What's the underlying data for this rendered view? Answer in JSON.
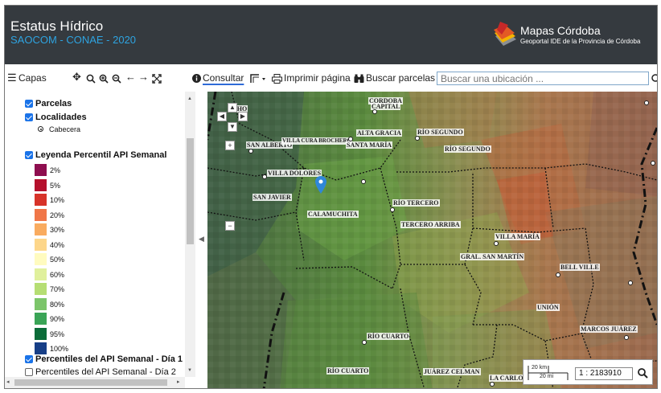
{
  "header": {
    "title": "Estatus Hídrico",
    "subtitle": "SAOCOM - CONAE - 2020",
    "logo_title": "Mapas Córdoba",
    "logo_subtitle": "Geoportal IDE de la Provincia de Córdoba",
    "colors": {
      "background": "#353a3f",
      "subtitle": "#2ea3e0"
    }
  },
  "toolbar": {
    "layers_label": "Capas",
    "consult_label": "Consultar",
    "print_label": "Imprimir página",
    "parcel_search_label": "Buscar parcelas",
    "search_placeholder": "Buscar una ubicación ...",
    "icons": [
      "menu-icon",
      "pan-icon",
      "zoom-box-icon",
      "zoom-in-icon",
      "zoom-out-icon",
      "back-icon",
      "forward-icon",
      "full-extent-icon",
      "info-icon",
      "draw-icon",
      "print-icon",
      "binoculars-icon",
      "search-icon"
    ]
  },
  "sidebar": {
    "layers": [
      {
        "label": "Parcelas",
        "checked": true
      },
      {
        "label": "Localidades",
        "checked": true
      },
      {
        "label": "Leyenda Percentil API Semanal",
        "checked": true
      },
      {
        "label": "Percentiles del API Semanal - Día 1",
        "checked": true
      },
      {
        "label": "Percentiles del API Semanal - Día 2",
        "checked": false
      }
    ],
    "localidades_sub": "Cabecera",
    "legend": [
      {
        "label": "2%",
        "color": "#8e0e4f"
      },
      {
        "label": "5%",
        "color": "#b5102c"
      },
      {
        "label": "10%",
        "color": "#d73329"
      },
      {
        "label": "20%",
        "color": "#f07648"
      },
      {
        "label": "30%",
        "color": "#f9ab5f"
      },
      {
        "label": "40%",
        "color": "#fdd68a"
      },
      {
        "label": "50%",
        "color": "#fffbbf"
      },
      {
        "label": "60%",
        "color": "#e0f09c"
      },
      {
        "label": "70%",
        "color": "#b6de73"
      },
      {
        "label": "80%",
        "color": "#7cc56a"
      },
      {
        "label": "90%",
        "color": "#3aa456"
      },
      {
        "label": "95%",
        "color": "#0b6c38"
      },
      {
        "label": "100%",
        "color": "#173f87"
      }
    ]
  },
  "map": {
    "places": [
      {
        "name": "CAPITAL"
      },
      {
        "name": "CORDOBA"
      },
      {
        "name": "SAN ALBERTO"
      },
      {
        "name": "VILLA CURA BROCHERO"
      },
      {
        "name": "ALTA GRACIA"
      },
      {
        "name": "SANTA MARÍA"
      },
      {
        "name": "RÍO SEGUNDO"
      },
      {
        "name": "RÍO SEGUNDO"
      },
      {
        "name": "VILLA DOLORES"
      },
      {
        "name": "SAN JAVIER"
      },
      {
        "name": "CALAMUCHITA"
      },
      {
        "name": "RÍO TERCERO"
      },
      {
        "name": "TERCERO ARRIBA"
      },
      {
        "name": "VILLA MARÍA"
      },
      {
        "name": "GRAL. SAN MARTÍN"
      },
      {
        "name": "BELL VILLE"
      },
      {
        "name": "UNIÓN"
      },
      {
        "name": "MARCOS JUÁREZ"
      },
      {
        "name": "RÍO CUARTO"
      },
      {
        "name": "RÍO CUARTO"
      },
      {
        "name": "JUÁREZ CELMAN"
      },
      {
        "name": "LA CARLOTA"
      },
      {
        "name": "CHO"
      }
    ],
    "scale_km": "20 km",
    "scale_mi": "20 mi",
    "scale_value": "1 : 2183910"
  }
}
